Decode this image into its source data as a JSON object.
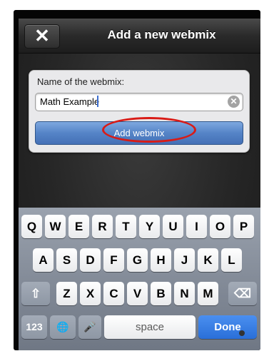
{
  "navbar": {
    "close_label": "✕",
    "title": "Add a new webmix"
  },
  "form": {
    "label": "Name of the webmix:",
    "name_value": "Math Example",
    "clear_glyph": "✕",
    "add_button_label": "Add webmix"
  },
  "keyboard": {
    "row1": [
      "Q",
      "W",
      "E",
      "R",
      "T",
      "Y",
      "U",
      "I",
      "O",
      "P"
    ],
    "row2": [
      "A",
      "S",
      "D",
      "F",
      "G",
      "H",
      "J",
      "K",
      "L"
    ],
    "row3": [
      "Z",
      "X",
      "C",
      "V",
      "B",
      "N",
      "M"
    ],
    "shift_glyph": "⇧",
    "delete_glyph": "⌫",
    "numbers_label": "123",
    "globe_glyph": "🌐",
    "mic_glyph": "🎤",
    "space_label": "space",
    "done_label": "Done"
  },
  "colors": {
    "accent_button": "#5584c7",
    "done_key": "#2a6fd8",
    "highlight_circle": "#d91b16"
  }
}
